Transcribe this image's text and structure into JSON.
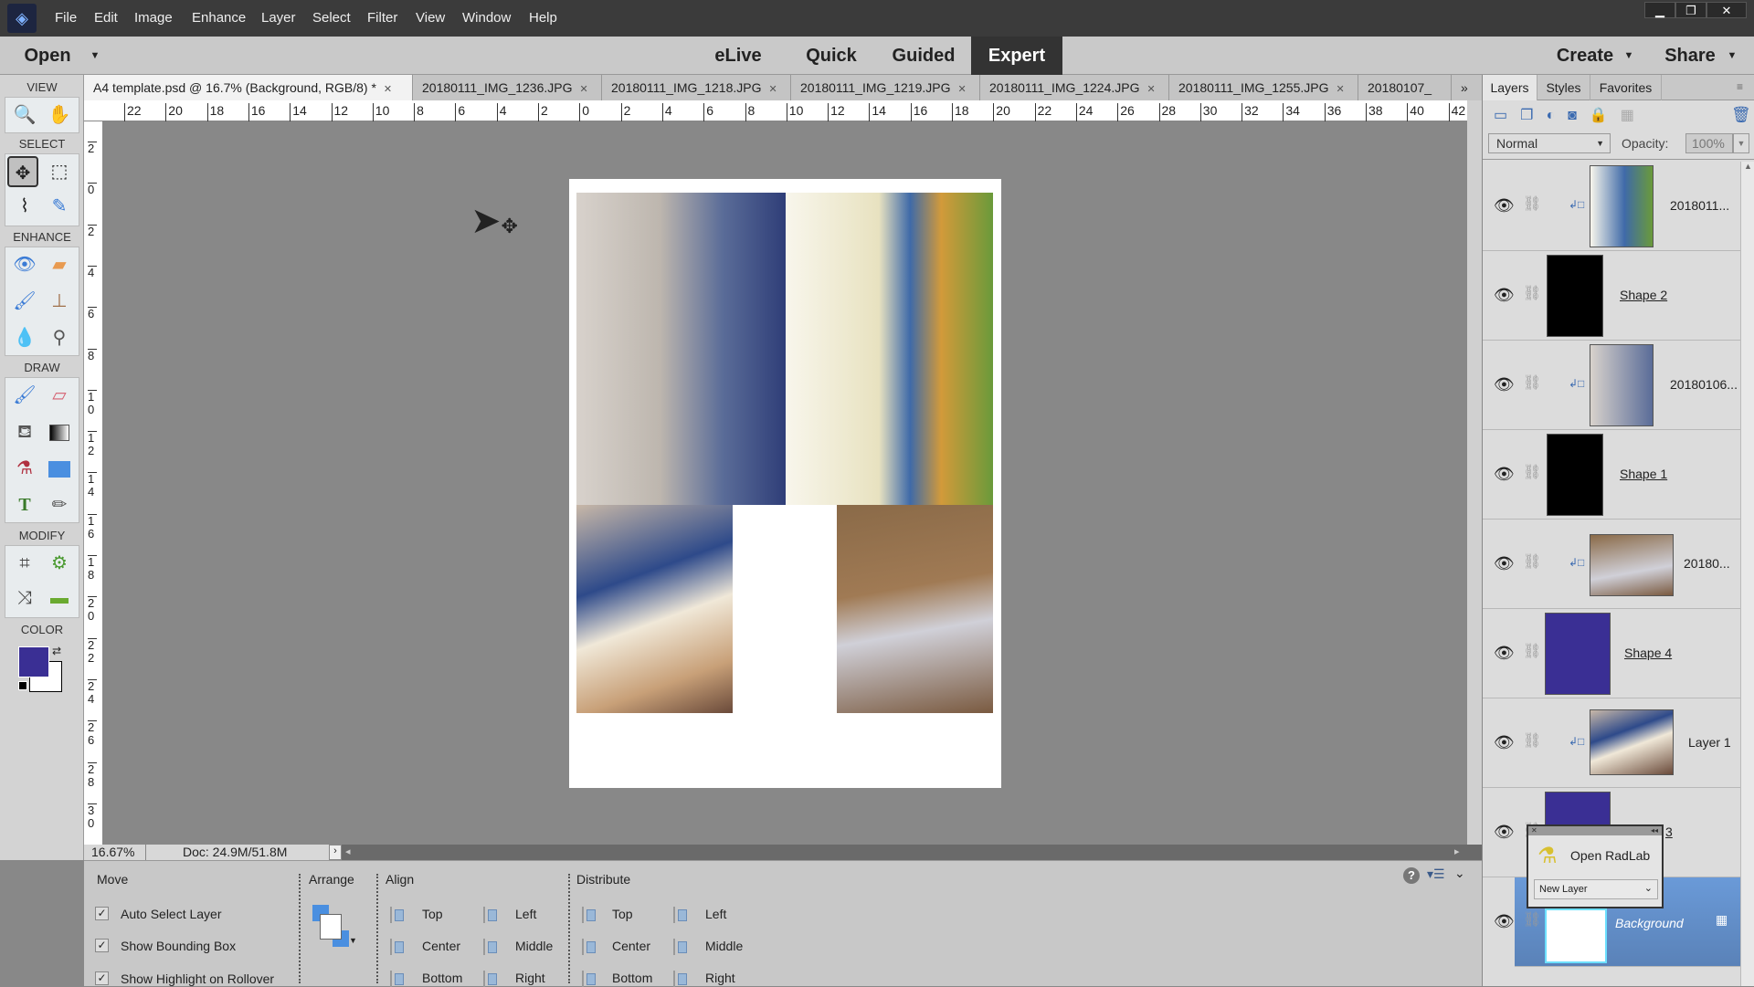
{
  "menubar": {
    "items": [
      "File",
      "Edit",
      "Image",
      "Enhance",
      "Layer",
      "Select",
      "Filter",
      "View",
      "Window",
      "Help"
    ],
    "window_controls": [
      "minimize",
      "restore",
      "close"
    ]
  },
  "modebar": {
    "open": "Open",
    "modes": [
      "eLive",
      "Quick",
      "Guided",
      "Expert"
    ],
    "active_mode": "Expert",
    "create": "Create",
    "share": "Share"
  },
  "doc_tabs": [
    {
      "label": "A4 template.psd @ 16.7% (Background, RGB/8) *",
      "active": true
    },
    {
      "label": "20180111_IMG_1236.JPG"
    },
    {
      "label": "20180111_IMG_1218.JPG"
    },
    {
      "label": "20180111_IMG_1219.JPG"
    },
    {
      "label": "20180111_IMG_1224.JPG"
    },
    {
      "label": "20180111_IMG_1255.JPG"
    },
    {
      "label": "20180107_"
    }
  ],
  "tools": {
    "sections": [
      "VIEW",
      "SELECT",
      "ENHANCE",
      "DRAW",
      "MODIFY",
      "COLOR"
    ],
    "foreground_color": "#3a2f94",
    "background_color": "#ffffff"
  },
  "ruler": {
    "h_ticks": [
      "22",
      "20",
      "18",
      "16",
      "14",
      "12",
      "10",
      "8",
      "6",
      "4",
      "2",
      "0",
      "2",
      "4",
      "6",
      "8",
      "10",
      "12",
      "14",
      "16",
      "18",
      "20",
      "22",
      "24",
      "26",
      "28",
      "30",
      "32",
      "34",
      "36",
      "38",
      "40",
      "42"
    ],
    "v_ticks": [
      "2",
      "0",
      "2",
      "4",
      "6",
      "8",
      "1 0",
      "1 2",
      "1 4",
      "1 6",
      "1 8",
      "2 0",
      "2 2",
      "2 4",
      "2 6",
      "2 8",
      "3 0"
    ]
  },
  "status": {
    "zoom": "16.67%",
    "doc": "Doc: 24.9M/51.8M"
  },
  "options": {
    "move": {
      "title": "Move",
      "checkboxes": [
        {
          "label": "Auto Select Layer",
          "checked": true
        },
        {
          "label": "Show Bounding Box",
          "checked": true
        },
        {
          "label": "Show Highlight on Rollover",
          "checked": true
        }
      ]
    },
    "arrange": {
      "title": "Arrange"
    },
    "align": {
      "title": "Align",
      "items": [
        "Top",
        "Center",
        "Bottom",
        "Left",
        "Middle",
        "Right"
      ]
    },
    "distribute": {
      "title": "Distribute",
      "items": [
        "Top",
        "Center",
        "Bottom",
        "Left",
        "Middle",
        "Right"
      ]
    }
  },
  "panel": {
    "tabs": [
      "Layers",
      "Styles",
      "Favorites"
    ],
    "active_tab": "Layers",
    "blend_mode": "Normal",
    "opacity_label": "Opacity:",
    "opacity": "100%",
    "layers": [
      {
        "name": "2018011...",
        "type": "image",
        "underline": false
      },
      {
        "name": "Shape 2",
        "type": "shape",
        "color": "#000000",
        "underline": true
      },
      {
        "name": "20180106...",
        "type": "image",
        "underline": false
      },
      {
        "name": "Shape 1",
        "type": "shape",
        "color": "#000000",
        "underline": true
      },
      {
        "name": "20180...",
        "type": "image",
        "underline": false
      },
      {
        "name": "Shape 4",
        "type": "shape",
        "color": "#3a2f94",
        "underline": true
      },
      {
        "name": "Layer 1",
        "type": "image",
        "underline": false
      },
      {
        "name": "3",
        "type": "shape",
        "color": "#3a2f94",
        "underline": true
      },
      {
        "name": "Background",
        "type": "background",
        "selected": true
      }
    ]
  },
  "radlab": {
    "title": "Open RadLab",
    "select": "New Layer"
  }
}
